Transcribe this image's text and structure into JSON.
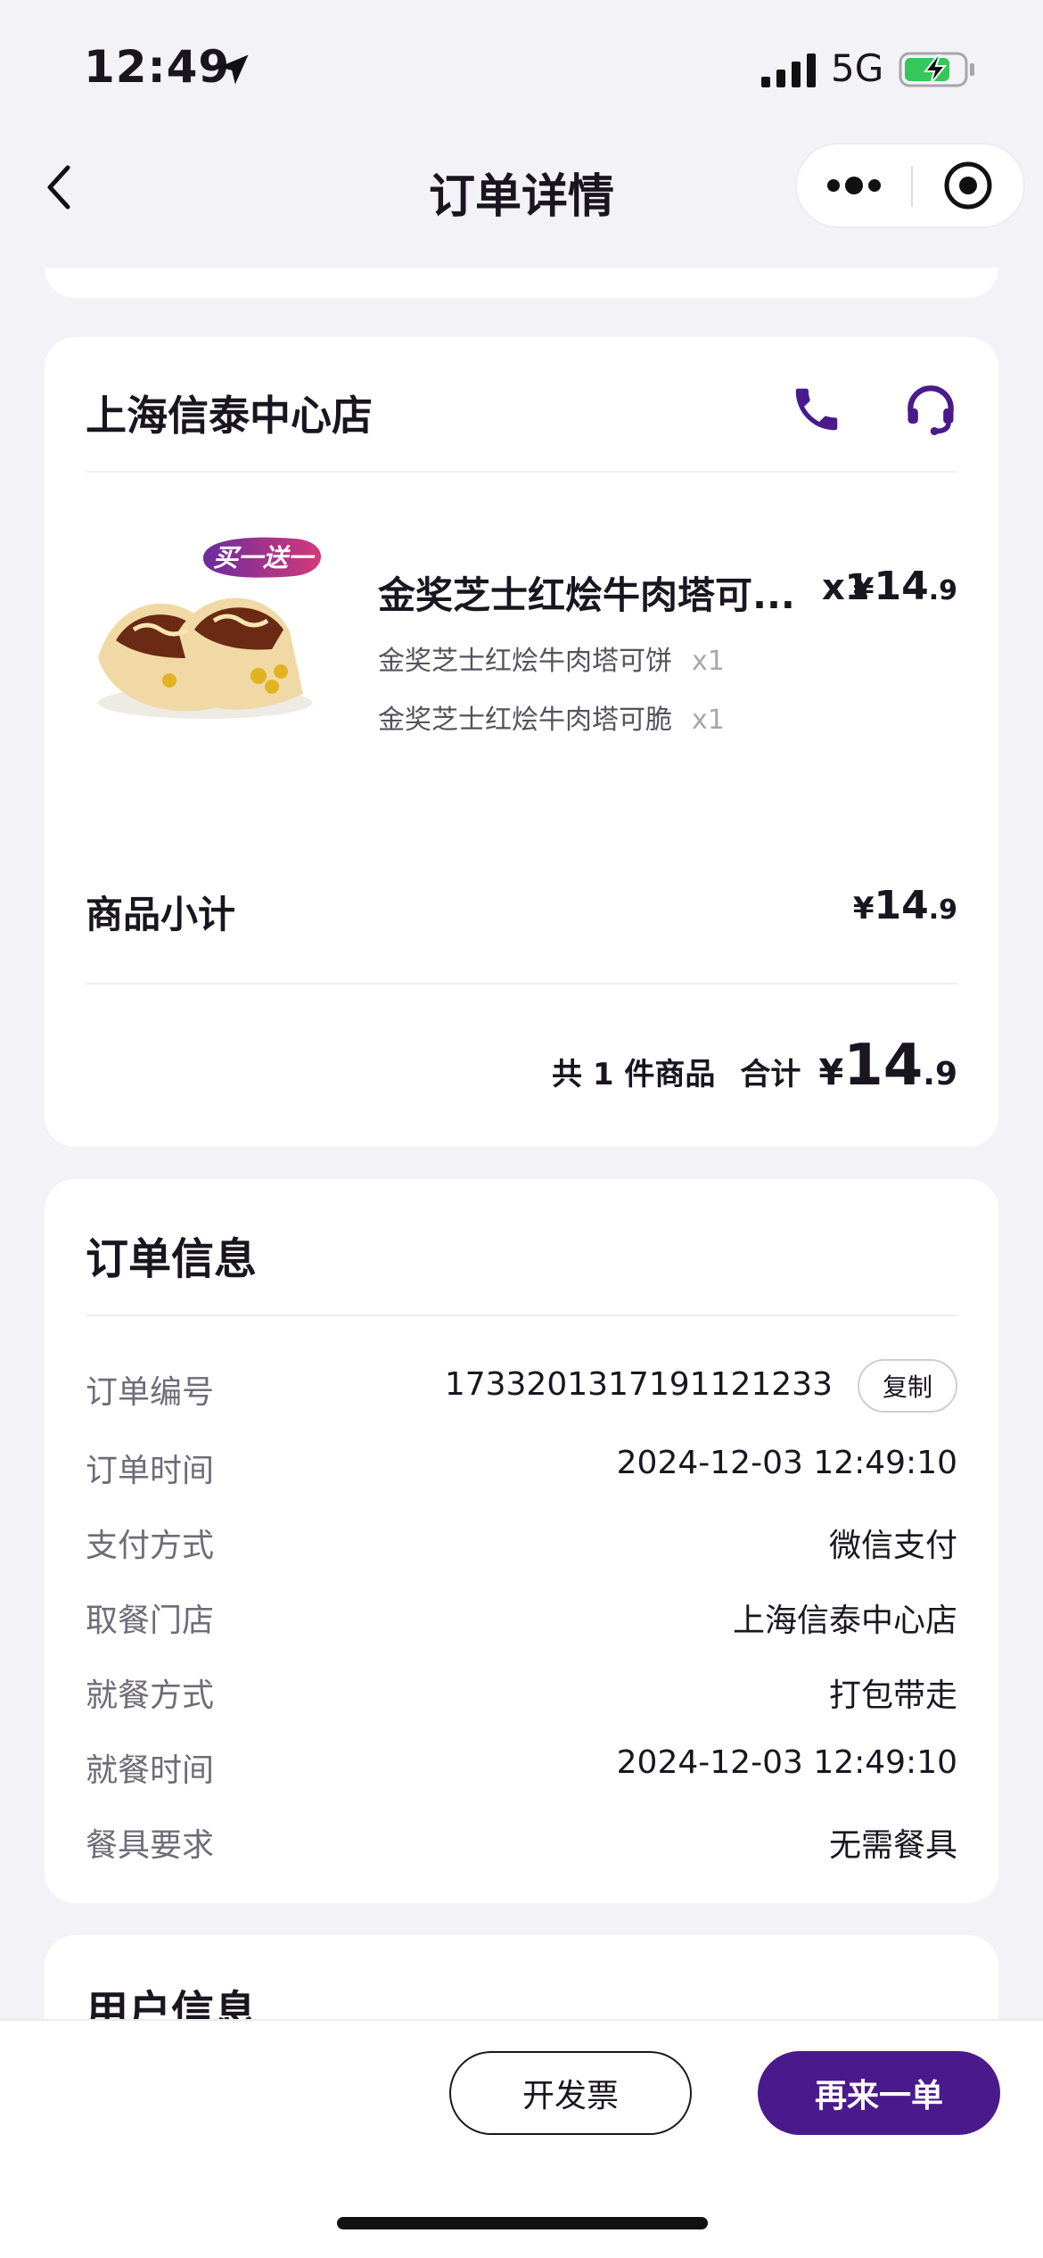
{
  "status_bar": {
    "time": "12:49",
    "network": "5G"
  },
  "nav": {
    "title": "订单详情"
  },
  "store": {
    "name": "上海信泰中心店"
  },
  "item": {
    "promo_badge": "买一送一",
    "name": "金奖芝士红烩牛肉塔可...",
    "qty": "x1",
    "price": {
      "symbol": "¥",
      "int": "14",
      "dec": ".9"
    },
    "sub_items": [
      {
        "name": "金奖芝士红烩牛肉塔可饼",
        "qty": "x1"
      },
      {
        "name": "金奖芝士红烩牛肉塔可脆",
        "qty": "x1"
      }
    ]
  },
  "subtotal": {
    "label": "商品小计",
    "price": {
      "symbol": "¥",
      "int": "14",
      "dec": ".9"
    }
  },
  "total": {
    "count_text": "共 1 件商品",
    "label": "合计",
    "price": {
      "symbol": "¥",
      "int": "14",
      "dec": ".9"
    }
  },
  "order_info": {
    "title": "订单信息",
    "copy_label": "复制",
    "rows": [
      {
        "label": "订单编号",
        "value": "17332013171911​21233"
      },
      {
        "label": "订单时间",
        "value": "2024-12-03 12:49:10"
      },
      {
        "label": "支付方式",
        "value": "微信支付"
      },
      {
        "label": "取餐门店",
        "value": "上海信泰中心店"
      },
      {
        "label": "就餐方式",
        "value": "打包带走"
      },
      {
        "label": "就餐时间",
        "value": "2024-12-03 12:49:10"
      },
      {
        "label": "餐具要求",
        "value": "无需餐具"
      }
    ]
  },
  "user_info": {
    "title": "用户信息"
  },
  "actions": {
    "invoice_label": "开发票",
    "reorder_label": "再来一单"
  },
  "colors": {
    "brand": "#4a1a8c",
    "background": "#f3f2f7",
    "card": "#ffffff"
  }
}
